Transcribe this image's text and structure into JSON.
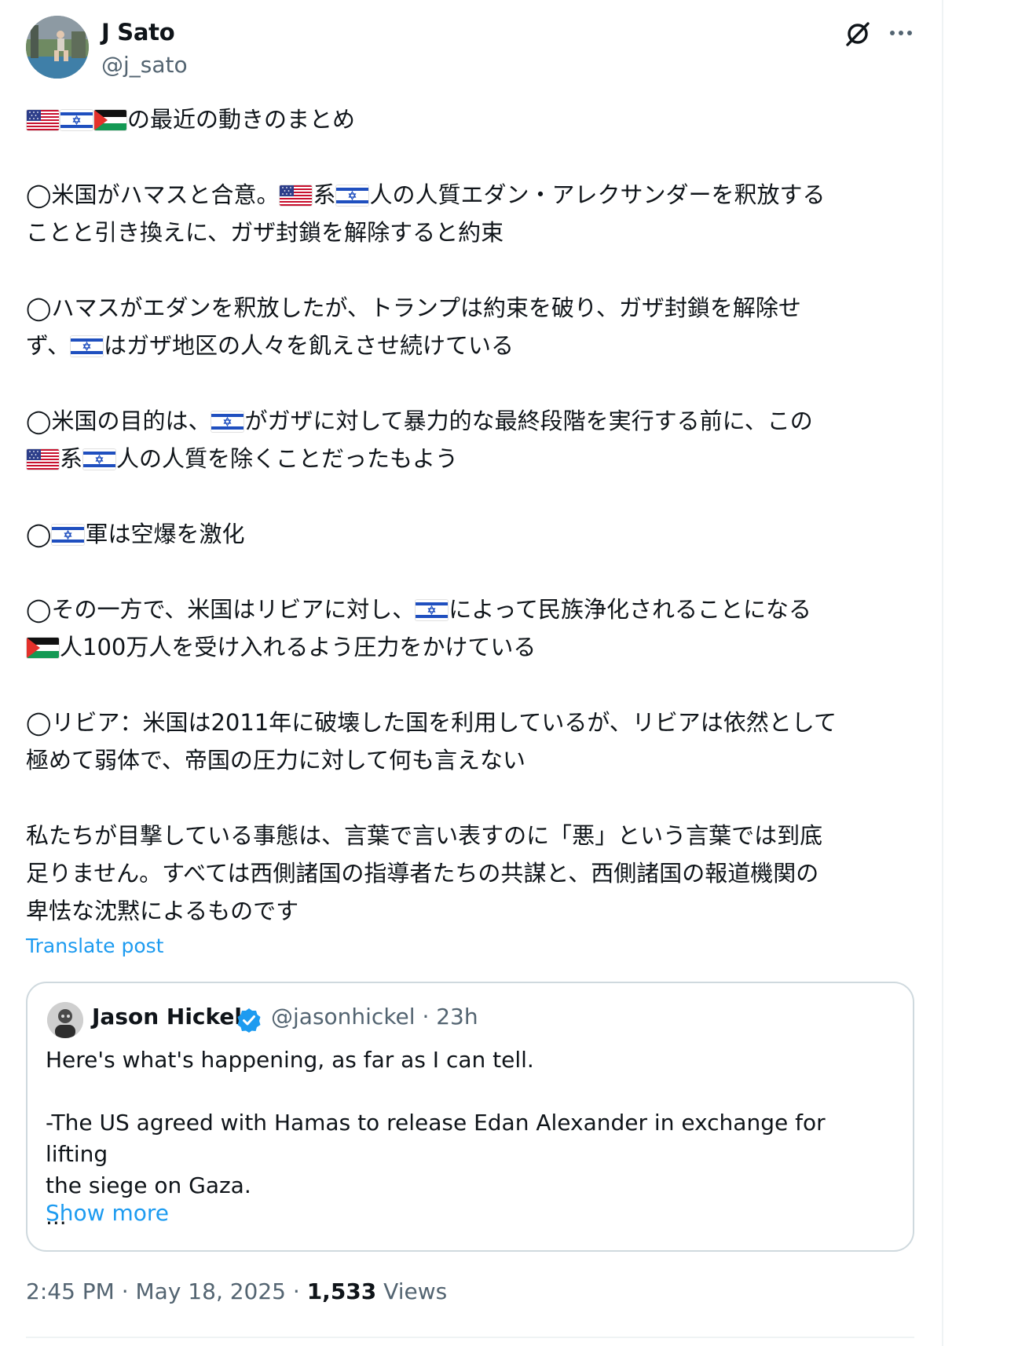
{
  "author": {
    "name": "J Sato",
    "handle": "@j_sato"
  },
  "post": {
    "paragraphs": [
      [
        {
          "flag": "us"
        },
        {
          "flag": "il"
        },
        {
          "flag": "ps"
        },
        {
          "text": "の最近の動きのまとめ"
        }
      ],
      [
        {
          "text": "◯米国がハマスと合意。"
        },
        {
          "flag": "us"
        },
        {
          "text": "系"
        },
        {
          "flag": "il"
        },
        {
          "text": "人の人質エダン・アレクサンダーを釈放する\nことと引き換えに、ガザ封鎖を解除すると約束"
        }
      ],
      [
        {
          "text": "◯ハマスがエダンを釈放したが、トランプは約束を破り、ガザ封鎖を解除せ\nず、"
        },
        {
          "flag": "il"
        },
        {
          "text": "はガザ地区の人々を飢えさせ続けている"
        }
      ],
      [
        {
          "text": "◯米国の目的は、"
        },
        {
          "flag": "il"
        },
        {
          "text": "がガザに対して暴力的な最終段階を実行する前に、この\n"
        },
        {
          "flag": "us"
        },
        {
          "text": "系"
        },
        {
          "flag": "il"
        },
        {
          "text": "人の人質を除くことだったもよう"
        }
      ],
      [
        {
          "text": "◯"
        },
        {
          "flag": "il"
        },
        {
          "text": "軍は空爆を激化"
        }
      ],
      [
        {
          "text": "◯その一方で、米国はリビアに対し、"
        },
        {
          "flag": "il"
        },
        {
          "text": "によって民族浄化されることになる\n"
        },
        {
          "flag": "ps"
        },
        {
          "text": "人100万人を受け入れるよう圧力をかけている"
        }
      ],
      [
        {
          "text": "◯リビア：米国は2011年に破壊した国を利用しているが、リビアは依然として\n極めて弱体で、帝国の圧力に対して何も言えない"
        }
      ],
      [
        {
          "text": "私たちが目撃している事態は、言葉で言い表すのに「悪」という言葉では到底\n足りません。すべては西側諸国の指導者たちの共謀と、西側諸国の報道機関の\n卑怯な沈黙によるものです"
        }
      ]
    ],
    "translate_label": "Translate post"
  },
  "quote": {
    "name": "Jason Hickel",
    "handle_time": "@jasonhickel · 23h",
    "lines": [
      "Here's what's happening, as far as I can tell.",
      "",
      "-The US agreed with Hamas to release Edan Alexander in exchange for lifting",
      "the siege on Gaza.",
      "..."
    ],
    "show_more": "Show more"
  },
  "meta": {
    "time_date": "2:45 PM · May 18, 2025 · ",
    "views_count": "1,533",
    "views_label": " Views"
  },
  "colors": {
    "link": "#1d9bf0",
    "secondary_text": "#536471",
    "border": "#cfd9de",
    "verified": "#1d9bf0"
  },
  "icons": {
    "header_actions": [
      "grok-icon",
      "more-icon"
    ],
    "quote_badge": "verified-badge-icon"
  }
}
